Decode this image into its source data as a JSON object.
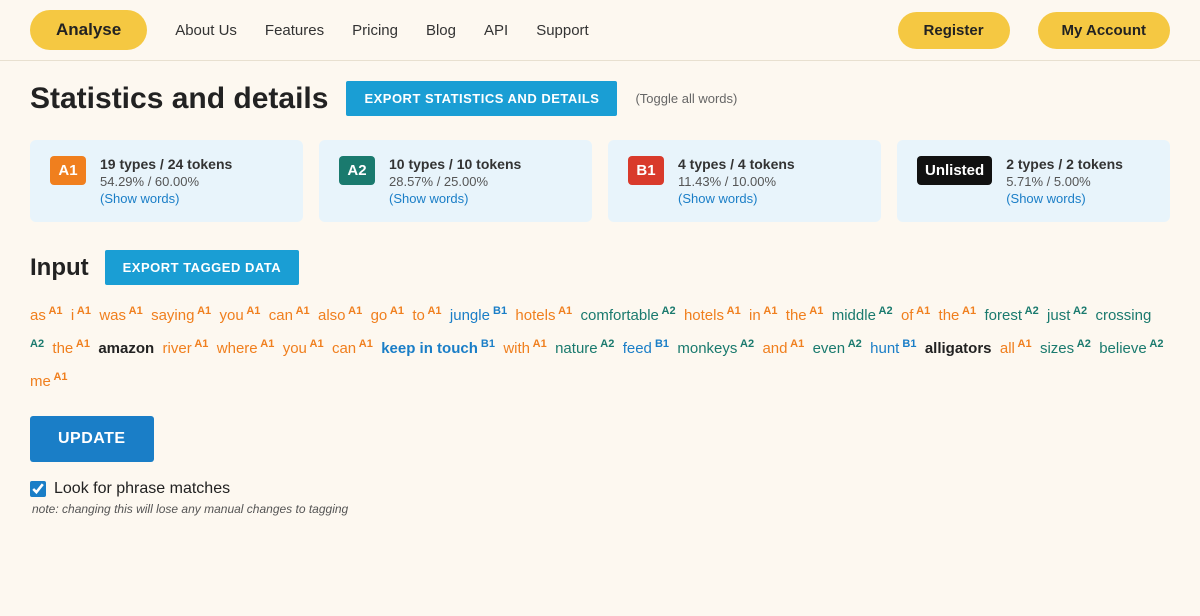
{
  "nav": {
    "analyse": "Analyse",
    "about": "About Us",
    "features": "Features",
    "pricing": "Pricing",
    "blog": "Blog",
    "api": "API",
    "support": "Support",
    "register": "Register",
    "myaccount": "My Account"
  },
  "header": {
    "title": "Statistics and details",
    "export_btn": "EXPORT STATISTICS AND DETAILS",
    "toggle_label": "(Toggle all words)"
  },
  "stats": [
    {
      "badge": "A1",
      "badge_class": "badge-a1",
      "types": "19 types / 24 tokens",
      "pct": "54.29% / 60.00%",
      "show": "(Show words)"
    },
    {
      "badge": "A2",
      "badge_class": "badge-a2",
      "types": "10 types / 10 tokens",
      "pct": "28.57% / 25.00%",
      "show": "(Show words)"
    },
    {
      "badge": "B1",
      "badge_class": "badge-b1",
      "types": "4 types / 4 tokens",
      "pct": "11.43% / 10.00%",
      "show": "(Show words)"
    },
    {
      "badge": "Unlisted",
      "badge_class": "badge-unlisted",
      "types": "2 types / 2 tokens",
      "pct": "5.71% / 5.00%",
      "show": "(Show words)"
    }
  ],
  "input": {
    "title": "Input",
    "export_btn": "EXPORT TAGGED DATA"
  },
  "phrase_match": {
    "label": "Look for phrase matches",
    "note": "note: changing this will lose any manual changes to tagging"
  },
  "update_btn": "UPDATE"
}
